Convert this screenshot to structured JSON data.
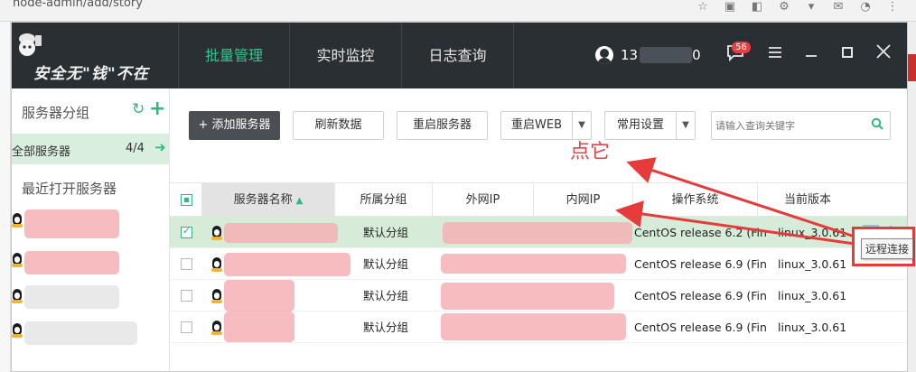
{
  "browser": {
    "url": "node-admin/add/story"
  },
  "app": {
    "logo_text": "安全无\"钱\"不在",
    "nav": [
      "批量管理",
      "实时监控",
      "日志查询"
    ],
    "user_name_visible": "13",
    "user_name_suffix": "0",
    "message_count": "56"
  },
  "sidebar": {
    "title": "服务器分组",
    "all_label": "全部服务器",
    "all_count": "4/4",
    "recent_label": "最近打开服务器"
  },
  "toolbar": {
    "add_label": "+ 添加服务器",
    "refresh_label": "刷新数据",
    "restart_label": "重启服务器",
    "restart_web_label": "重启WEB",
    "settings_label": "常用设置",
    "search_placeholder": "请输入查询关键字"
  },
  "table": {
    "headers": [
      "服务器名称",
      "所属分组",
      "外网IP",
      "内网IP",
      "操作系统",
      "当前版本"
    ],
    "rows": [
      {
        "group": "默认分组",
        "os": "CentOS release 6.2 (Fin",
        "version": "linux_3.0.61",
        "checked": true
      },
      {
        "group": "默认分组",
        "os": "CentOS release 6.9 (Fin",
        "version": "linux_3.0.61",
        "checked": false
      },
      {
        "group": "默认分组",
        "os": "CentOS release 6.9 (Fin",
        "version": "linux_3.0.61",
        "checked": false
      },
      {
        "group": "默认分组",
        "os": "CentOS release 6.9 (Fin",
        "version": "linux_3.0.61",
        "checked": false
      }
    ]
  },
  "annotation": {
    "text": "点它",
    "tooltip": "远程连接"
  },
  "colors": {
    "accent": "#31b77f",
    "titlebar": "#2a2f34",
    "annotation": "#e53b3b"
  }
}
